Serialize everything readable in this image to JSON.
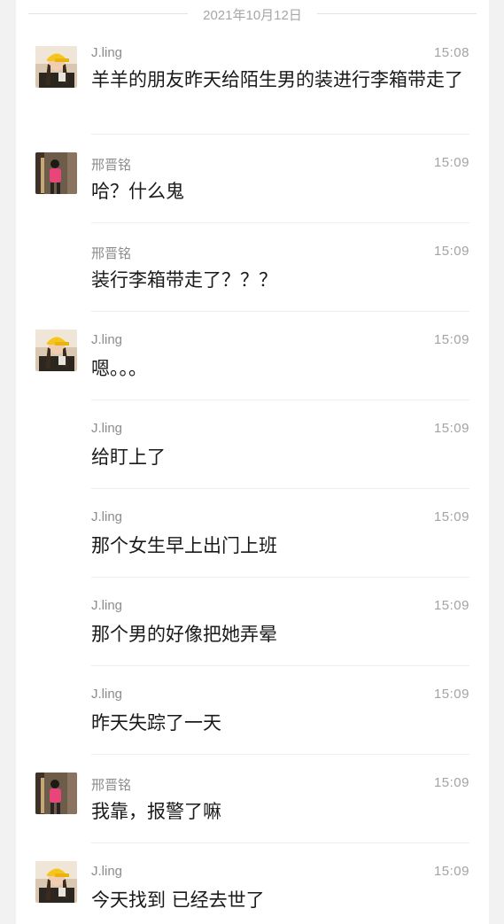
{
  "date": "2021年10月12日",
  "messages": [
    {
      "sender": "J.ling",
      "time": "15:08",
      "text": "羊羊的朋友昨天给陌生男的装进行李箱带走了",
      "avatar": "avatar-jling"
    },
    {
      "sender": "邢晋铭",
      "time": "15:09",
      "text": "哈？什么鬼",
      "avatar": "avatar-xing"
    },
    {
      "sender": "邢晋铭",
      "time": "15:09",
      "text": "装行李箱带走了？？？",
      "avatar": ""
    },
    {
      "sender": "J.ling",
      "time": "15:09",
      "text": "嗯。。。",
      "avatar": "avatar-jling"
    },
    {
      "sender": "J.ling",
      "time": "15:09",
      "text": "给盯上了",
      "avatar": ""
    },
    {
      "sender": "J.ling",
      "time": "15:09",
      "text": "那个女生早上出门上班",
      "avatar": ""
    },
    {
      "sender": "J.ling",
      "time": "15:09",
      "text": "那个男的好像把她弄晕",
      "avatar": ""
    },
    {
      "sender": "J.ling",
      "time": "15:09",
      "text": "昨天失踪了一天",
      "avatar": ""
    },
    {
      "sender": "邢晋铭",
      "time": "15:09",
      "text": "我靠，报警了嘛",
      "avatar": "avatar-xing"
    },
    {
      "sender": "J.ling",
      "time": "15:09",
      "text": "今天找到 已经去世了",
      "avatar": "avatar-jling"
    }
  ]
}
